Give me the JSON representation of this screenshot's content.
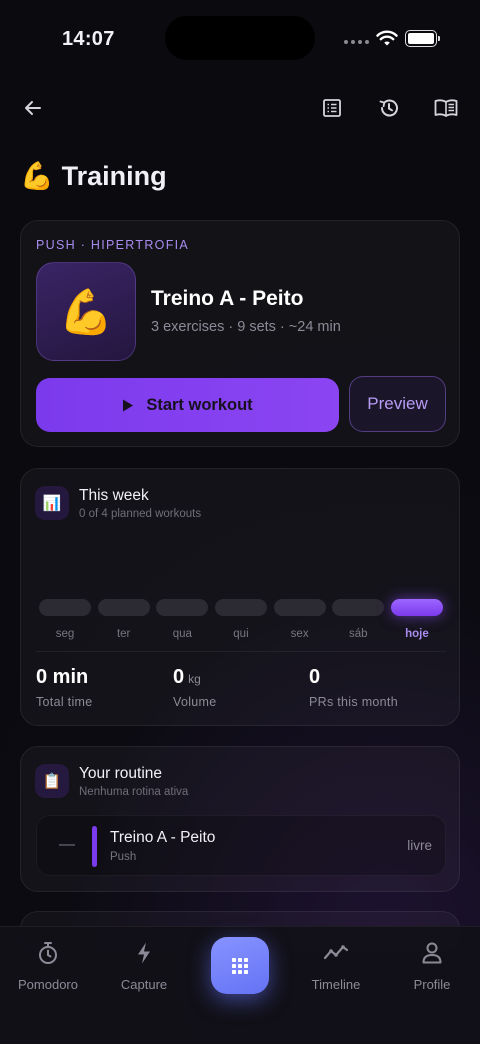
{
  "status_bar": {
    "time": "14:07"
  },
  "page": {
    "title_emoji": "💪",
    "title": "Training"
  },
  "workout": {
    "eyebrow": "PUSH · HIPERTROFIA",
    "emoji": "💪",
    "name": "Treino A - Peito",
    "meta": "3 exercises · 9 sets · ~24 min",
    "start_label": "Start workout",
    "preview_label": "Preview"
  },
  "week": {
    "icon": "📊",
    "title": "This week",
    "subtitle": "0 of 4 planned workouts",
    "days": [
      {
        "label": "seg",
        "today": false
      },
      {
        "label": "ter",
        "today": false
      },
      {
        "label": "qua",
        "today": false
      },
      {
        "label": "qui",
        "today": false
      },
      {
        "label": "sex",
        "today": false
      },
      {
        "label": "sáb",
        "today": false
      },
      {
        "label": "hoje",
        "today": true
      }
    ],
    "stats": {
      "time": {
        "value": "0 min",
        "caption": "Total time"
      },
      "volume": {
        "value": "0",
        "unit": "kg",
        "caption": "Volume"
      },
      "prs": {
        "value": "0",
        "caption": "PRs this month"
      }
    }
  },
  "routine": {
    "icon": "📋",
    "title": "Your routine",
    "subtitle": "Nenhuma rotina ativa",
    "item": {
      "dash": "—",
      "name": "Treino A - Peito",
      "type": "Push",
      "status": "livre"
    }
  },
  "tabs": {
    "pomodoro": "Pomodoro",
    "capture": "Capture",
    "timeline": "Timeline",
    "profile": "Profile"
  },
  "colors": {
    "accent": "#7c3aed",
    "accent_light": "#a98cf0",
    "center_button": "#6f7cf8"
  },
  "icons": [
    "back-arrow-icon",
    "list-icon",
    "history-icon",
    "book-icon",
    "play-icon",
    "timer-icon",
    "bolt-icon",
    "grid-icon",
    "trend-icon",
    "user-icon"
  ]
}
